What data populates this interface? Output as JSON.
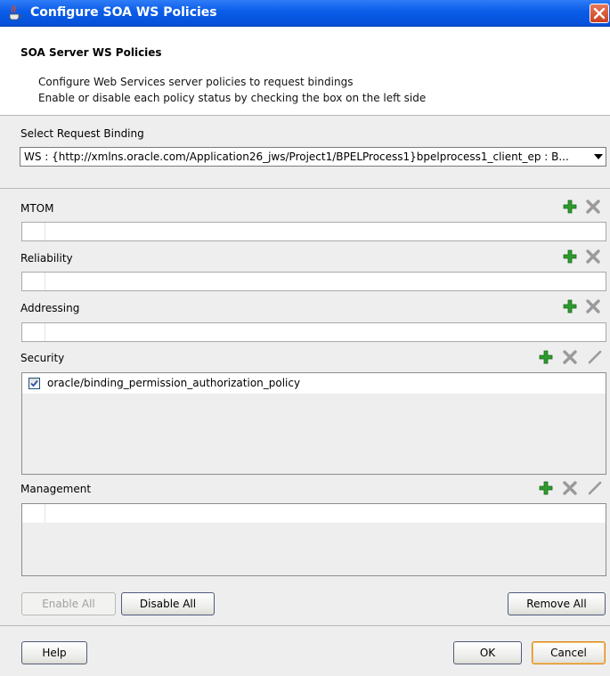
{
  "window": {
    "title": "Configure SOA WS Policies"
  },
  "header": {
    "title": "SOA Server WS Policies",
    "line1": "Configure Web Services server policies to request bindings",
    "line2": "Enable or disable each policy status by checking the box on the left side"
  },
  "binding": {
    "label": "Select Request Binding",
    "value": "WS : {http://xmlns.oracle.com/Application26_jws/Project1/BPELProcess1}bpelprocess1_client_ep : B..."
  },
  "sections": {
    "mtom": {
      "label": "MTOM"
    },
    "reliability": {
      "label": "Reliability"
    },
    "addressing": {
      "label": "Addressing"
    },
    "security": {
      "label": "Security",
      "items": [
        {
          "label": "oracle/binding_permission_authorization_policy",
          "checked": true
        }
      ]
    },
    "management": {
      "label": "Management"
    }
  },
  "buttons": {
    "enable_all": "Enable All",
    "disable_all": "Disable All",
    "remove_all": "Remove All",
    "help": "Help",
    "ok": "OK",
    "cancel": "Cancel"
  },
  "colors": {
    "titlebar": "#0a5ce8",
    "add_icon": "#2e9a2e",
    "delete_icon": "#9a9a9a",
    "checkbox_check": "#2a4ea8"
  },
  "icons": {
    "title": "coffee-cup-icon",
    "add": "plus-icon",
    "delete": "x-icon",
    "edit": "pencil-icon"
  }
}
